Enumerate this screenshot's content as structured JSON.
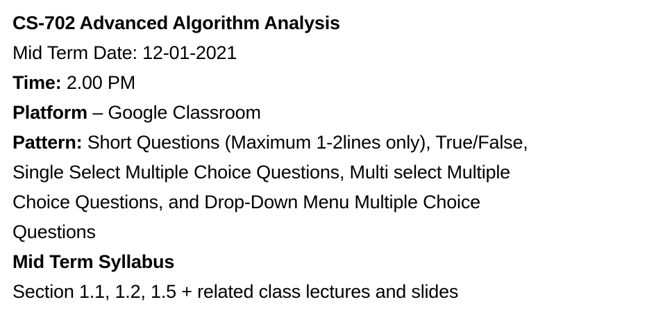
{
  "document": {
    "title": "CS-702 Advanced Algorithm Analysis",
    "mid_term_date": {
      "label": "Mid Term Date:",
      "value": "12-01-2021"
    },
    "time": {
      "label": "Time:",
      "value": "2.00 PM"
    },
    "platform": {
      "label": "Platform",
      "separator": "–",
      "value": "Google Classroom"
    },
    "pattern": {
      "label": "Pattern:",
      "line1": "Short Questions (Maximum 1-2lines only), True/False,",
      "line2": "Single Select Multiple Choice Questions, Multi select Multiple",
      "line3": "Choice Questions, and Drop-Down Menu Multiple Choice",
      "line4": "Questions"
    },
    "syllabus": {
      "heading": "Mid Term Syllabus",
      "content": "Section 1.1, 1.2, 1.5 + related class lectures and slides"
    }
  }
}
